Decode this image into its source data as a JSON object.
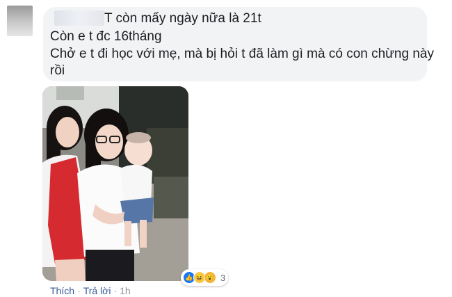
{
  "comment": {
    "lines": [
      "T còn mấy ngày nữa là 21t",
      "Còn e t đc 16tháng",
      "Chở e t đi học với mẹ, mà bị hỏi t đã làm gì mà có con chừng này",
      "rồi"
    ]
  },
  "reactions": {
    "icons": [
      "like-icon",
      "haha-icon",
      "wow-icon"
    ],
    "count": "3"
  },
  "actions": {
    "like": "Thích",
    "reply": "Trả lời",
    "time": "1h"
  },
  "colors": {
    "bubble": "#f2f3f5",
    "link": "#385898",
    "like": "#1877f2"
  }
}
